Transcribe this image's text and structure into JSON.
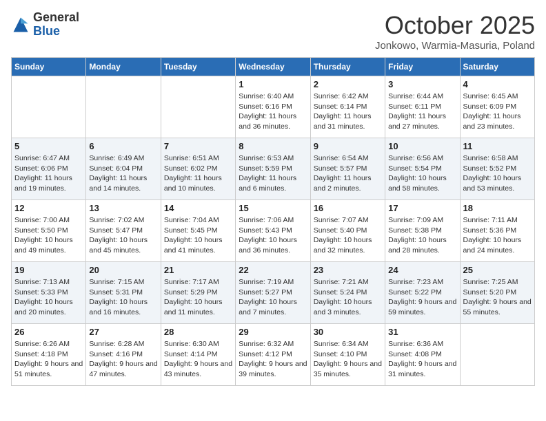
{
  "header": {
    "logo_general": "General",
    "logo_blue": "Blue",
    "month": "October 2025",
    "location": "Jonkowo, Warmia-Masuria, Poland"
  },
  "days_of_week": [
    "Sunday",
    "Monday",
    "Tuesday",
    "Wednesday",
    "Thursday",
    "Friday",
    "Saturday"
  ],
  "weeks": [
    [
      {
        "day": "",
        "info": ""
      },
      {
        "day": "",
        "info": ""
      },
      {
        "day": "",
        "info": ""
      },
      {
        "day": "1",
        "info": "Sunrise: 6:40 AM\nSunset: 6:16 PM\nDaylight: 11 hours and 36 minutes."
      },
      {
        "day": "2",
        "info": "Sunrise: 6:42 AM\nSunset: 6:14 PM\nDaylight: 11 hours and 31 minutes."
      },
      {
        "day": "3",
        "info": "Sunrise: 6:44 AM\nSunset: 6:11 PM\nDaylight: 11 hours and 27 minutes."
      },
      {
        "day": "4",
        "info": "Sunrise: 6:45 AM\nSunset: 6:09 PM\nDaylight: 11 hours and 23 minutes."
      }
    ],
    [
      {
        "day": "5",
        "info": "Sunrise: 6:47 AM\nSunset: 6:06 PM\nDaylight: 11 hours and 19 minutes."
      },
      {
        "day": "6",
        "info": "Sunrise: 6:49 AM\nSunset: 6:04 PM\nDaylight: 11 hours and 14 minutes."
      },
      {
        "day": "7",
        "info": "Sunrise: 6:51 AM\nSunset: 6:02 PM\nDaylight: 11 hours and 10 minutes."
      },
      {
        "day": "8",
        "info": "Sunrise: 6:53 AM\nSunset: 5:59 PM\nDaylight: 11 hours and 6 minutes."
      },
      {
        "day": "9",
        "info": "Sunrise: 6:54 AM\nSunset: 5:57 PM\nDaylight: 11 hours and 2 minutes."
      },
      {
        "day": "10",
        "info": "Sunrise: 6:56 AM\nSunset: 5:54 PM\nDaylight: 10 hours and 58 minutes."
      },
      {
        "day": "11",
        "info": "Sunrise: 6:58 AM\nSunset: 5:52 PM\nDaylight: 10 hours and 53 minutes."
      }
    ],
    [
      {
        "day": "12",
        "info": "Sunrise: 7:00 AM\nSunset: 5:50 PM\nDaylight: 10 hours and 49 minutes."
      },
      {
        "day": "13",
        "info": "Sunrise: 7:02 AM\nSunset: 5:47 PM\nDaylight: 10 hours and 45 minutes."
      },
      {
        "day": "14",
        "info": "Sunrise: 7:04 AM\nSunset: 5:45 PM\nDaylight: 10 hours and 41 minutes."
      },
      {
        "day": "15",
        "info": "Sunrise: 7:06 AM\nSunset: 5:43 PM\nDaylight: 10 hours and 36 minutes."
      },
      {
        "day": "16",
        "info": "Sunrise: 7:07 AM\nSunset: 5:40 PM\nDaylight: 10 hours and 32 minutes."
      },
      {
        "day": "17",
        "info": "Sunrise: 7:09 AM\nSunset: 5:38 PM\nDaylight: 10 hours and 28 minutes."
      },
      {
        "day": "18",
        "info": "Sunrise: 7:11 AM\nSunset: 5:36 PM\nDaylight: 10 hours and 24 minutes."
      }
    ],
    [
      {
        "day": "19",
        "info": "Sunrise: 7:13 AM\nSunset: 5:33 PM\nDaylight: 10 hours and 20 minutes."
      },
      {
        "day": "20",
        "info": "Sunrise: 7:15 AM\nSunset: 5:31 PM\nDaylight: 10 hours and 16 minutes."
      },
      {
        "day": "21",
        "info": "Sunrise: 7:17 AM\nSunset: 5:29 PM\nDaylight: 10 hours and 11 minutes."
      },
      {
        "day": "22",
        "info": "Sunrise: 7:19 AM\nSunset: 5:27 PM\nDaylight: 10 hours and 7 minutes."
      },
      {
        "day": "23",
        "info": "Sunrise: 7:21 AM\nSunset: 5:24 PM\nDaylight: 10 hours and 3 minutes."
      },
      {
        "day": "24",
        "info": "Sunrise: 7:23 AM\nSunset: 5:22 PM\nDaylight: 9 hours and 59 minutes."
      },
      {
        "day": "25",
        "info": "Sunrise: 7:25 AM\nSunset: 5:20 PM\nDaylight: 9 hours and 55 minutes."
      }
    ],
    [
      {
        "day": "26",
        "info": "Sunrise: 6:26 AM\nSunset: 4:18 PM\nDaylight: 9 hours and 51 minutes."
      },
      {
        "day": "27",
        "info": "Sunrise: 6:28 AM\nSunset: 4:16 PM\nDaylight: 9 hours and 47 minutes."
      },
      {
        "day": "28",
        "info": "Sunrise: 6:30 AM\nSunset: 4:14 PM\nDaylight: 9 hours and 43 minutes."
      },
      {
        "day": "29",
        "info": "Sunrise: 6:32 AM\nSunset: 4:12 PM\nDaylight: 9 hours and 39 minutes."
      },
      {
        "day": "30",
        "info": "Sunrise: 6:34 AM\nSunset: 4:10 PM\nDaylight: 9 hours and 35 minutes."
      },
      {
        "day": "31",
        "info": "Sunrise: 6:36 AM\nSunset: 4:08 PM\nDaylight: 9 hours and 31 minutes."
      },
      {
        "day": "",
        "info": ""
      }
    ]
  ]
}
